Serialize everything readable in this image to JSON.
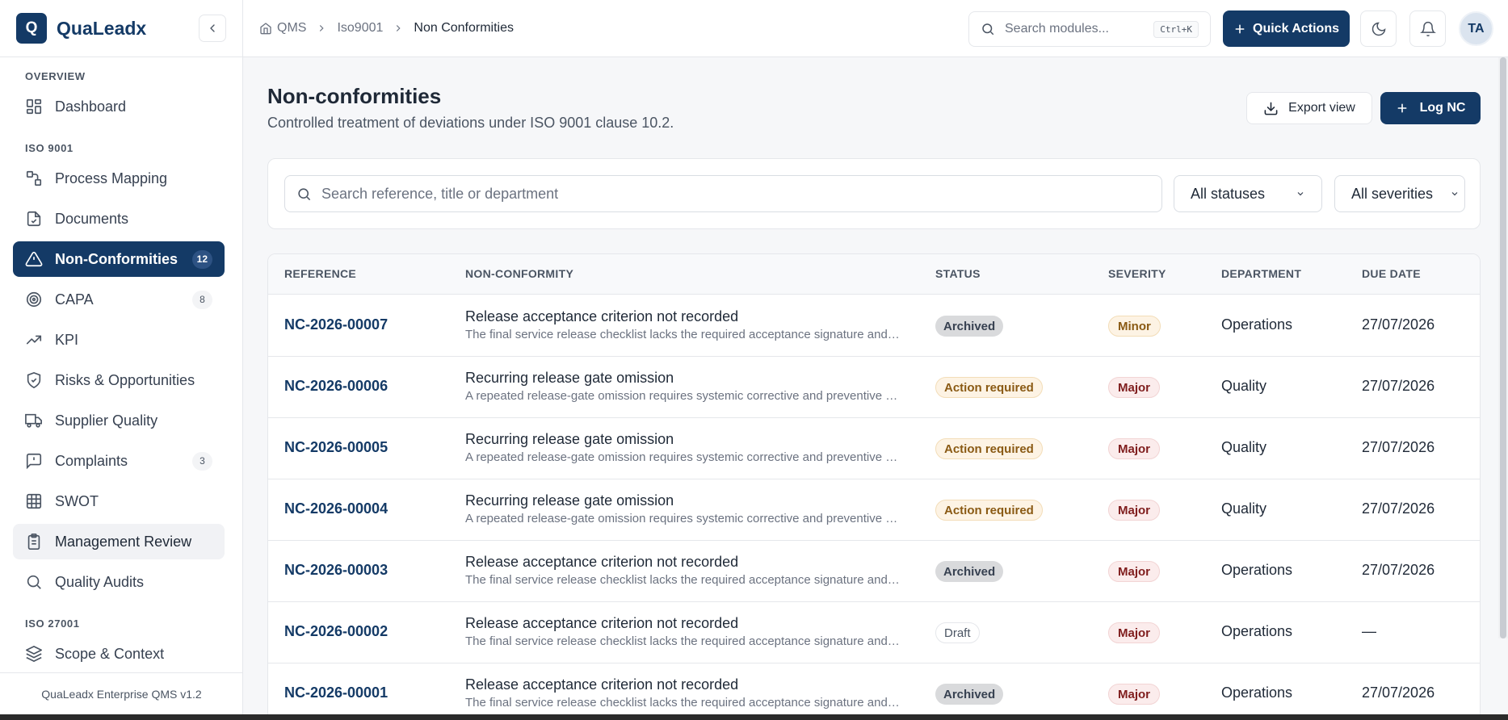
{
  "brand": {
    "logo_letter": "Q",
    "name": "QuaLeadx"
  },
  "sidebar": {
    "sections": [
      {
        "label": "OVERVIEW"
      },
      {
        "label": "ISO 9001"
      },
      {
        "label": "ISO 27001"
      }
    ],
    "items": [
      {
        "label": "Dashboard",
        "icon": "dashboard-icon"
      },
      {
        "label": "Process Mapping",
        "icon": "process-icon"
      },
      {
        "label": "Documents",
        "icon": "document-icon"
      },
      {
        "label": "Non-Conformities",
        "icon": "warning-icon",
        "badge": "12",
        "active": true
      },
      {
        "label": "CAPA",
        "icon": "target-icon",
        "badge": "8"
      },
      {
        "label": "KPI",
        "icon": "trend-icon"
      },
      {
        "label": "Risks & Opportunities",
        "icon": "shield-icon"
      },
      {
        "label": "Supplier Quality",
        "icon": "truck-icon"
      },
      {
        "label": "Complaints",
        "icon": "message-alert-icon",
        "badge": "3"
      },
      {
        "label": "SWOT",
        "icon": "grid-icon"
      },
      {
        "label": "Management Review",
        "icon": "clipboard-icon"
      },
      {
        "label": "Quality Audits",
        "icon": "search-icon"
      },
      {
        "label": "Scope & Context",
        "icon": "layers-icon"
      }
    ],
    "footer": "QuaLeadx Enterprise QMS v1.2"
  },
  "topbar": {
    "breadcrumb": [
      "QMS",
      "Iso9001",
      "Non Conformities"
    ],
    "search_placeholder": "Search modules...",
    "search_shortcut": "Ctrl+K",
    "quick_actions": "Quick Actions",
    "avatar_initials": "TA"
  },
  "page": {
    "title": "Non-conformities",
    "subtitle": "Controlled treatment of deviations under ISO 9001 clause 10.2.",
    "export_label": "Export view",
    "log_label": "Log NC"
  },
  "filters": {
    "search_placeholder": "Search reference, title or department",
    "status_value": "All statuses",
    "severity_value": "All severities"
  },
  "table": {
    "headers": [
      "REFERENCE",
      "NON-CONFORMITY",
      "STATUS",
      "SEVERITY",
      "DEPARTMENT",
      "DUE DATE"
    ],
    "rows": [
      {
        "ref": "NC-2026-00007",
        "title": "Release acceptance criterion not recorded",
        "desc": "The final service release checklist lacks the required acceptance signature and record.",
        "status": "Archived",
        "status_kind": "archived",
        "severity": "Minor",
        "severity_kind": "minor",
        "department": "Operations",
        "due": "27/07/2026"
      },
      {
        "ref": "NC-2026-00006",
        "title": "Recurring release gate omission",
        "desc": "A repeated release-gate omission requires systemic corrective and preventive action.",
        "status": "Action required",
        "status_kind": "action",
        "severity": "Major",
        "severity_kind": "major",
        "department": "Quality",
        "due": "27/07/2026"
      },
      {
        "ref": "NC-2026-00005",
        "title": "Recurring release gate omission",
        "desc": "A repeated release-gate omission requires systemic corrective and preventive action.",
        "status": "Action required",
        "status_kind": "action",
        "severity": "Major",
        "severity_kind": "major",
        "department": "Quality",
        "due": "27/07/2026"
      },
      {
        "ref": "NC-2026-00004",
        "title": "Recurring release gate omission",
        "desc": "A repeated release-gate omission requires systemic corrective and preventive action.",
        "status": "Action required",
        "status_kind": "action",
        "severity": "Major",
        "severity_kind": "major",
        "department": "Quality",
        "due": "27/07/2026"
      },
      {
        "ref": "NC-2026-00003",
        "title": "Release acceptance criterion not recorded",
        "desc": "The final service release checklist lacks the required acceptance signature and record.",
        "status": "Archived",
        "status_kind": "archived",
        "severity": "Major",
        "severity_kind": "major",
        "department": "Operations",
        "due": "27/07/2026"
      },
      {
        "ref": "NC-2026-00002",
        "title": "Release acceptance criterion not recorded",
        "desc": "The final service release checklist lacks the required acceptance signature and record.",
        "status": "Draft",
        "status_kind": "draft",
        "severity": "Major",
        "severity_kind": "major",
        "department": "Operations",
        "due": "—"
      },
      {
        "ref": "NC-2026-00001",
        "title": "Release acceptance criterion not recorded",
        "desc": "The final service release checklist lacks the required acceptance signature and record.",
        "status": "Archived",
        "status_kind": "archived",
        "severity": "Major",
        "severity_kind": "major",
        "department": "Operations",
        "due": "27/07/2026"
      }
    ]
  },
  "colors": {
    "brand": "#143a66",
    "background": "#f6f7f9",
    "border": "#e5e7eb"
  }
}
